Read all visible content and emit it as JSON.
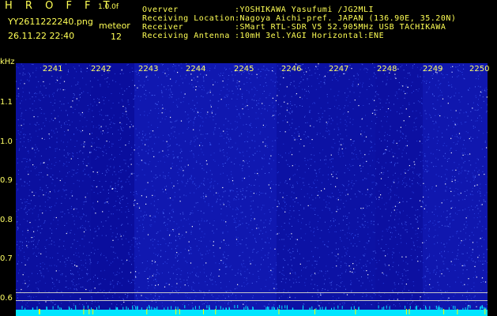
{
  "header": {
    "app_title": "H R O F F T",
    "version": "1.0.0f",
    "filename": "YY2611222240.png",
    "datetime": "26.11.22 22:40",
    "mode_label": "meteor",
    "count": "12",
    "info": [
      {
        "label": "Overver",
        "value": ":YOSHIKAWA Yasufumi /JG2MLI"
      },
      {
        "label": "Receiving Location",
        "value": ":Nagoya Aichi-pref. JAPAN (136.90E, 35.20N)"
      },
      {
        "label": "Receiver",
        "value": ":SMart RTL-SDR V5 52.905MHz USB TACHIKAWA"
      },
      {
        "label": "Receiving Antenna",
        "value": ":10mH 3el.YAGI Horizontal:ENE"
      }
    ]
  },
  "plot": {
    "y_unit": "kHz",
    "y_ticks": [
      "1.1",
      "1.0",
      "0.9",
      "0.8",
      "0.7",
      "0.6"
    ],
    "x_ticks": [
      "2241",
      "2242",
      "2243",
      "2244",
      "2245",
      "2246",
      "2247",
      "2248",
      "2249",
      "2250"
    ],
    "colors": {
      "background": "#0a0d9a",
      "noise": "#3a5cff",
      "spark": "#ffffff",
      "floor": "#00e5ff",
      "marker": "#ffff00"
    }
  }
}
